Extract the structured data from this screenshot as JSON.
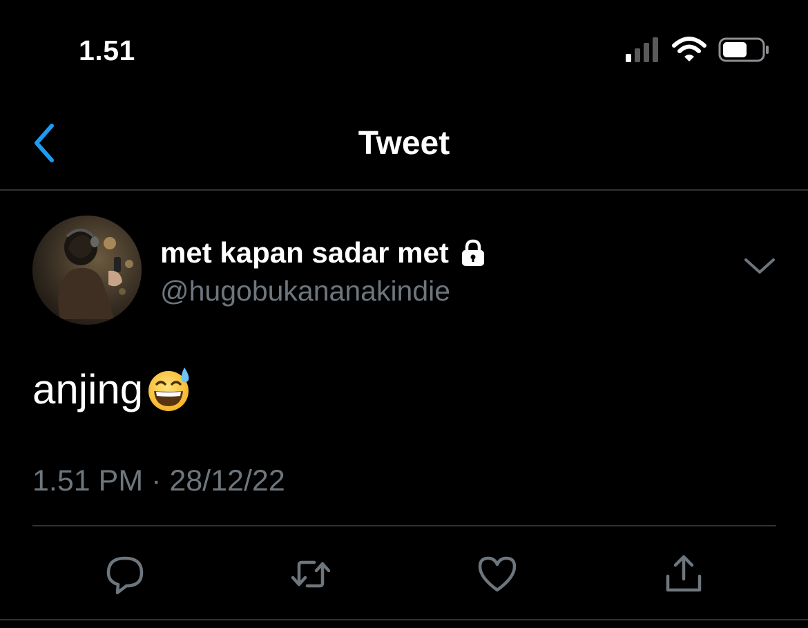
{
  "status_bar": {
    "time": "1.51"
  },
  "nav": {
    "title": "Tweet"
  },
  "tweet": {
    "display_name": "met kapan sadar met",
    "handle": "@hugobukananakindie",
    "text": "anjing",
    "timestamp": "1.51 PM · 28/12/22"
  },
  "icons": {
    "back": "chevron-left-icon",
    "lock": "lock-icon",
    "menu": "chevron-down-icon",
    "emoji": "grinning-face-with-sweat-emoji",
    "reply": "speech-bubble-icon",
    "retweet": "retweet-icon",
    "like": "heart-icon",
    "share": "share-icon"
  },
  "colors": {
    "background": "#000000",
    "text": "#ffffff",
    "secondary": "#6e767d",
    "accent": "#1d9bf0",
    "divider": "#2f3336"
  }
}
